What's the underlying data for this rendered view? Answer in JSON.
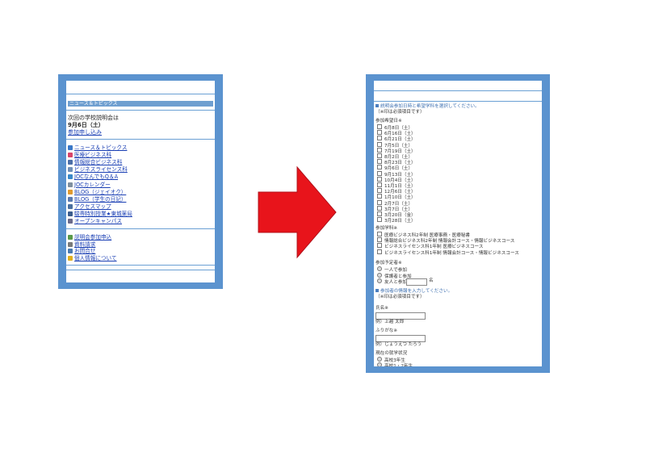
{
  "phone1": {
    "header_bar": "ニュース＆トピックス",
    "next_session_label": "次回の学校説明会は",
    "next_session_date": "9月6日（土）",
    "apply_link": "参加申し込み",
    "menu": [
      {
        "label": "ニュース＆トピックス",
        "icon": "globe-icon",
        "color": "#3a78c8"
      },
      {
        "label": "医療ビジネス科",
        "icon": "heart-icon",
        "color": "#d9446a"
      },
      {
        "label": "情報総合ビジネス科",
        "icon": "computer-icon",
        "color": "#4c6fa8"
      },
      {
        "label": "ビジネスライセンス科",
        "icon": "document-icon",
        "color": "#6f8fb8"
      },
      {
        "label": "JOCなんでもQ＆A",
        "icon": "question-icon",
        "color": "#3a88c8"
      },
      {
        "label": "JOCカレンダー",
        "icon": "calendar-icon",
        "color": "#7f8f9f"
      },
      {
        "label": "BLOG（ジェイオク）",
        "icon": "pencil-icon",
        "color": "#e09a30"
      },
      {
        "label": "BLOG（学生の日記）",
        "icon": "book-icon",
        "color": "#5a7ab0"
      },
      {
        "label": "アクセスマップ",
        "icon": "car-icon",
        "color": "#4a6f9f"
      },
      {
        "label": "駿専特別授業★東城薬局",
        "icon": "building-icon",
        "color": "#3c5c8c"
      },
      {
        "label": "オープンキャンパス",
        "icon": "door-icon",
        "color": "#6a6a8a"
      }
    ],
    "menu2": [
      {
        "label": "説明会参加申込",
        "icon": "person-icon",
        "color": "#5a9a4a"
      },
      {
        "label": "資料請求",
        "icon": "paper-icon",
        "color": "#7a7a7a"
      },
      {
        "label": "お問合せ",
        "icon": "mail-icon",
        "color": "#4a7ab0"
      },
      {
        "label": "個人情報について",
        "icon": "smile-icon",
        "color": "#e0b020"
      }
    ]
  },
  "phone2": {
    "section1": "説明会参加日時と希望学科を選択してください。",
    "required_note": "（※印は必須項目です）",
    "dates_label": "参加希望日",
    "dates": [
      "6月8日（土）",
      "6月16日（土）",
      "6月21日（土）",
      "7月5日（土）",
      "7月19日（土）",
      "8月2日（土）",
      "8月23日（土）",
      "9月6日（土）",
      "9月13日（土）",
      "10月4日（土）",
      "11月1日（土）",
      "12月6日（土）",
      "1月10日（土）",
      "2月7日（土）",
      "3月7日（土）",
      "3月20日（金）",
      "3月28日（土）"
    ],
    "course_label": "参加学科",
    "courses": [
      "医療ビジネス科2年制 医療事務・医療秘書",
      "情報総合ビジネス科2年制 情報会計コース・情報ビジネスコース",
      "ビジネスライセンス科1年制 医療ビジネスコース",
      "ビジネスライセンス科1年制 情報会計コース・情報ビジネスコース"
    ],
    "count_label": "参加予定者",
    "count_options": [
      "一人で参加",
      "保護者と参加",
      "友人と参加"
    ],
    "count_suffix": "名",
    "section2": "参加者の情報を入力してください。",
    "required_note2": "（※印は必須項目です）",
    "name_label": "氏名",
    "name_example": "例）上越 太郎",
    "kana_label": "ふりがな",
    "kana_example": "例）じょうえつ たろう",
    "status_label": "現在の就学状況",
    "status_options": [
      "高校3年生",
      "高校1・2年生"
    ],
    "required_mark": "※"
  },
  "colors": {
    "frame": "#5b93cf",
    "arrow": "#e8141b",
    "link": "#1a3fb4"
  }
}
